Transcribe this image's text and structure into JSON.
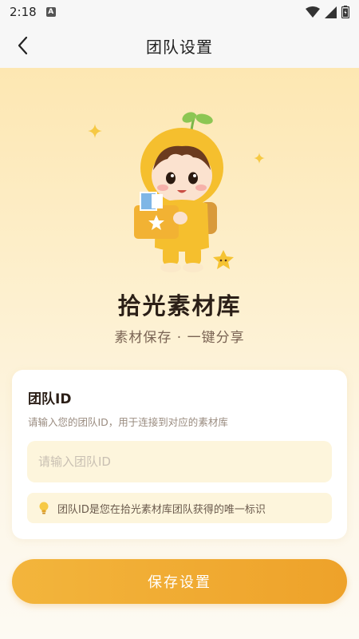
{
  "status_bar": {
    "time": "2:18",
    "badge": "A",
    "icons": [
      "wifi-icon",
      "signal-icon",
      "battery-icon"
    ]
  },
  "header": {
    "title": "团队设置",
    "back_icon": "chevron-left-icon"
  },
  "hero": {
    "brand_name": "拾光素材库",
    "slogan": "素材保存 · 一键分享"
  },
  "card": {
    "title": "团队ID",
    "description": "请输入您的团队ID，用于连接到对应的素材库",
    "input": {
      "value": "",
      "placeholder": "请输入团队ID"
    },
    "tip": {
      "icon": "lightbulb-icon",
      "text": "团队ID是您在拾光素材库团队获得的唯一标识"
    }
  },
  "save_button": {
    "label": "保存设置"
  },
  "colors": {
    "accent": "#F0A92F",
    "hero_bg": "#FDE7B2",
    "input_bg": "#FDF5DC",
    "title_text": "#2B1F17"
  }
}
